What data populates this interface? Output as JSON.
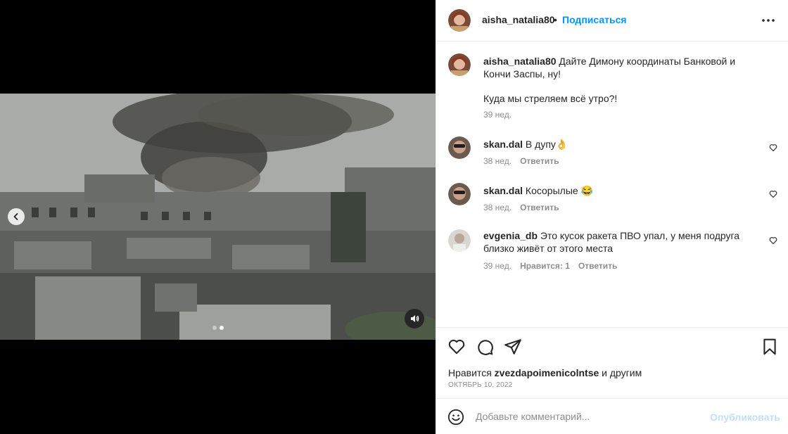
{
  "post": {
    "author": "aisha_natalia80",
    "separator": "•",
    "follow_label": "Подписаться"
  },
  "comments": [
    {
      "username": "aisha_natalia80",
      "text": "Дайте Димону координаты Банковой и Кончи Заспы, ну!",
      "text2": "Куда мы стреляем всё утро?!",
      "time": "39 нед."
    },
    {
      "username": "skan.dal",
      "text": "В дупу👌",
      "time": "38 нед.",
      "reply_label": "Ответить"
    },
    {
      "username": "skan.dal",
      "text": "Косорылые 😂",
      "time": "38 нед.",
      "reply_label": "Ответить"
    },
    {
      "username": "evgenia_db",
      "text": "Это кусок ракета ПВО упал, у меня подруга близко живёт от этого места",
      "time": "39 нед.",
      "likes_label": "Нравится: 1",
      "reply_label": "Ответить"
    }
  ],
  "likes": {
    "prefix": "Нравится",
    "user": "zvezdapoimenicolntse",
    "suffix": "и другим"
  },
  "date": "ОКТЯБРЬ 10, 2022",
  "add_comment": {
    "placeholder": "Добавьте комментарий...",
    "publish_label": "Опубликовать"
  },
  "icons": [
    "chevron-left-icon",
    "sound-icon",
    "more-icon",
    "heart-icon",
    "comment-icon",
    "share-icon",
    "bookmark-icon",
    "emoji-icon"
  ],
  "colors": {
    "accent": "#0095f6",
    "publish_disabled": "#c0dffd",
    "muted": "#8e8e8e",
    "text": "#262626"
  }
}
